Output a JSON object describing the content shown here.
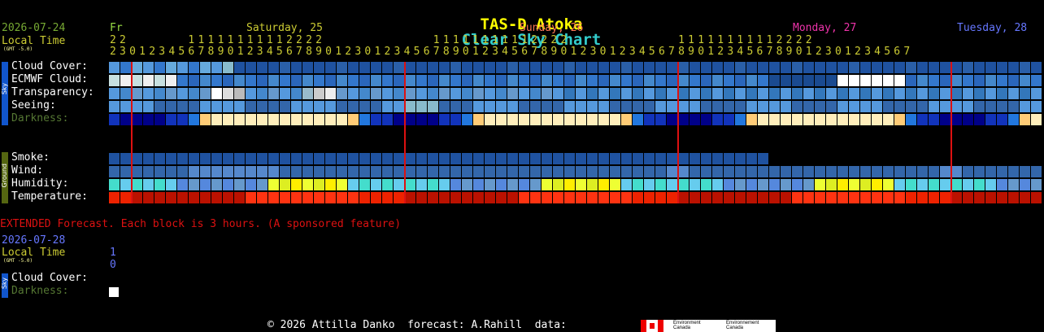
{
  "title": {
    "part1": "TAS-D Atoka",
    "part2": "Clear Sky Chart"
  },
  "colors": {
    "yellow": "#ffff00",
    "cyan": "#33cccc",
    "red": "#dd1111",
    "green": "#77aa33",
    "olive": "#778800",
    "blue": "#3366ff"
  },
  "header": {
    "date": "2026-07-24",
    "local_time": "Local Time",
    "gmt": "(GMT -5.0)",
    "day0": "Fr",
    "day1": "Saturday, 25",
    "day2": "Sunday, 26",
    "day3": "Monday, 27",
    "day4": "Tuesday, 28",
    "tens_row": "2 2             1 1 1 1 1 1 1 1 1 1 2 2 2 2                       1 1 1 1 1 1 1 1 1 1 2 2 2 2                       1 1 1 1 1 1 1 1 1 1 2 2 2 2",
    "ones_row": "2 3 0 1 2 3 4 5 6 7 8 9 0 1 2 3 4 5 6 7 8 9 0 1 2 3 0 1 2 3 4 5 6 7 8 9 0 1 2 3 4 5 6 7 8 9 0 1 2 3 0 1 2 3 4 5 6 7 8 9 0 1 2 3 4 5 6 7 8 9 0 1 2 3 0 1 2 3 4 5 6 7"
  },
  "sky_tab": "Sky",
  "ground_tab": "Ground",
  "rows": {
    "cloud": "Cloud Cover:",
    "ecmwf": "ECMWF Cloud:",
    "transparency": "Transparency:",
    "seeing": "Seeing:",
    "darkness": "Darkness:",
    "smoke": "Smoke:",
    "wind": "Wind:",
    "humidity": "Humidity:",
    "temperature": "Temperature:"
  },
  "extended": {
    "note": "EXTENDED Forecast. Each block is 3 hours. (A sponsored feature)",
    "date": "2026-07-28",
    "local_time": "Local Time",
    "gmt": "(GMT -5.0)",
    "hour_tens": "1",
    "hour_ones": "0",
    "cloud": "Cloud Cover:",
    "darkness": "Darkness:"
  },
  "footer": {
    "copyright": "© 2026 Attilla Danko  forecast: A.Rahill  data:",
    "agency_en": "Environment Canada",
    "agency_fr": "Environnement Canada"
  }
}
